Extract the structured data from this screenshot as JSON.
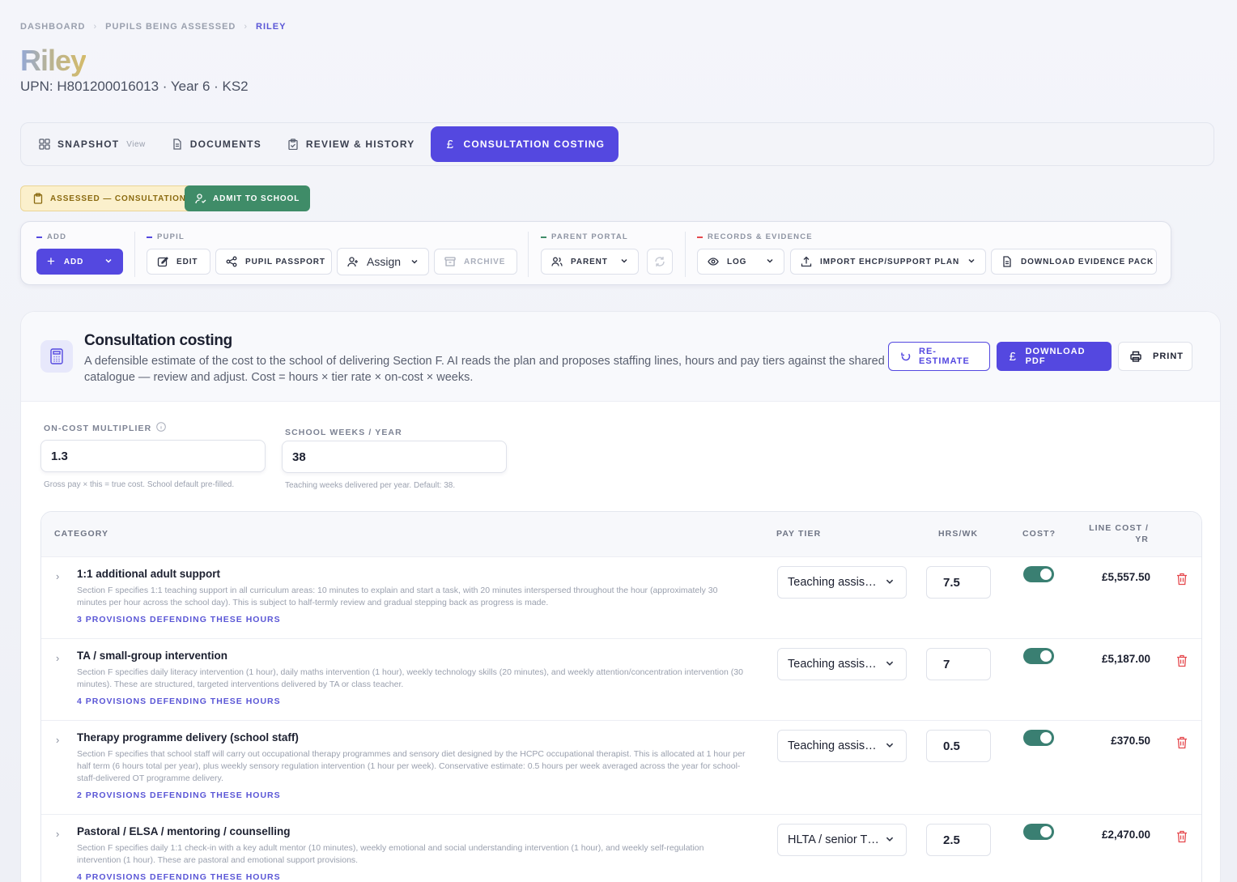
{
  "breadcrumb": [
    "DASHBOARD",
    "PUPILS BEING ASSESSED",
    "RILEY"
  ],
  "pupil": {
    "name": "Riley",
    "details": "UPN: H801200016013 · Year 6 · KS2"
  },
  "tabs": [
    {
      "label": "SNAPSHOT",
      "extra": "View",
      "icon": "grid-icon"
    },
    {
      "label": "DOCUMENTS",
      "icon": "document-icon"
    },
    {
      "label": "REVIEW & HISTORY",
      "icon": "clipboard-icon"
    },
    {
      "label": "CONSULTATION COSTING",
      "icon": "pound-icon",
      "active": true
    }
  ],
  "status": {
    "badge": "ASSESSED — CONSULTATION",
    "admit": "ADMIT TO SCHOOL"
  },
  "toolbar": {
    "add": {
      "label": "ADD",
      "button": "ADD"
    },
    "pupil": {
      "label": "PUPIL",
      "edit": "EDIT",
      "passport": "PUPIL PASSPORT",
      "assign": "Assign",
      "archive": "ARCHIVE"
    },
    "parent": {
      "label": "PARENT PORTAL",
      "parent": "PARENT"
    },
    "records": {
      "label": "RECORDS & EVIDENCE",
      "log": "LOG",
      "import": "IMPORT EHCP/SUPPORT PLAN",
      "download": "DOWNLOAD EVIDENCE PACK"
    }
  },
  "colors": {
    "accent": "#5448e0",
    "success": "#3f8c68",
    "toggle_on": "#3a7f72",
    "danger": "#e5484d"
  },
  "costing": {
    "title": "Consultation costing",
    "description": "A defensible estimate of the cost to the school of delivering Section F. AI reads the plan and proposes staffing lines, hours and pay tiers against the shared catalogue — review and adjust. Cost = hours × tier rate × on-cost × weeks.",
    "reestimate": "RE-ESTIMATE",
    "download_pdf": "DOWNLOAD PDF",
    "print": "PRINT",
    "oncost": {
      "label": "ON-COST MULTIPLIER",
      "value": "1.3",
      "hint": "Gross pay × this = true cost. School default pre-filled."
    },
    "weeks": {
      "label": "SCHOOL WEEKS / YEAR",
      "value": "38",
      "hint": "Teaching weeks delivered per year. Default: 38."
    }
  },
  "table": {
    "headers": {
      "category": "CATEGORY",
      "pay_tier": "PAY TIER",
      "hrs": "HRS/WK",
      "cost": "COST?",
      "line_cost_1": "LINE COST /",
      "line_cost_2": "YR"
    },
    "rows": [
      {
        "name": "1:1 additional adult support",
        "desc": "Section F specifies 1:1 teaching support in all curriculum areas: 10 minutes to explain and start a task, with 20 minutes interspersed throughout the hour (approximately 30 minutes per hour across the school day). This is subject to half-termly review and gradual stepping back as progress is made.",
        "link": "3 PROVISIONS DEFENDING THESE HOURS",
        "tier": "Teaching assis…",
        "hrs": "7.5",
        "cost_on": true,
        "line_cost": "£5,557.50"
      },
      {
        "name": "TA / small-group intervention",
        "desc": "Section F specifies daily literacy intervention (1 hour), daily maths intervention (1 hour), weekly technology skills (20 minutes), and weekly attention/concentration intervention (30 minutes). These are structured, targeted interventions delivered by TA or class teacher.",
        "link": "4 PROVISIONS DEFENDING THESE HOURS",
        "tier": "Teaching assis…",
        "hrs": "7",
        "cost_on": true,
        "line_cost": "£5,187.00"
      },
      {
        "name": "Therapy programme delivery (school staff)",
        "desc": "Section F specifies that school staff will carry out occupational therapy programmes and sensory diet designed by the HCPC occupational therapist. This is allocated at 1 hour per half term (6 hours total per year), plus weekly sensory regulation intervention (1 hour per week). Conservative estimate: 0.5 hours per week averaged across the year for school-staff-delivered OT programme delivery.",
        "link": "2 PROVISIONS DEFENDING THESE HOURS",
        "tier": "Teaching assis…",
        "hrs": "0.5",
        "cost_on": true,
        "line_cost": "£370.50"
      },
      {
        "name": "Pastoral / ELSA / mentoring / counselling",
        "desc": "Section F specifies daily 1:1 check-in with a key adult mentor (10 minutes), weekly emotional and social understanding intervention (1 hour), and weekly self-regulation intervention (1 hour). These are pastoral and emotional support provisions.",
        "link": "4 PROVISIONS DEFENDING THESE HOURS",
        "tier": "HLTA / senior T…",
        "hrs": "2.5",
        "cost_on": true,
        "line_cost": "£2,470.00"
      }
    ]
  }
}
